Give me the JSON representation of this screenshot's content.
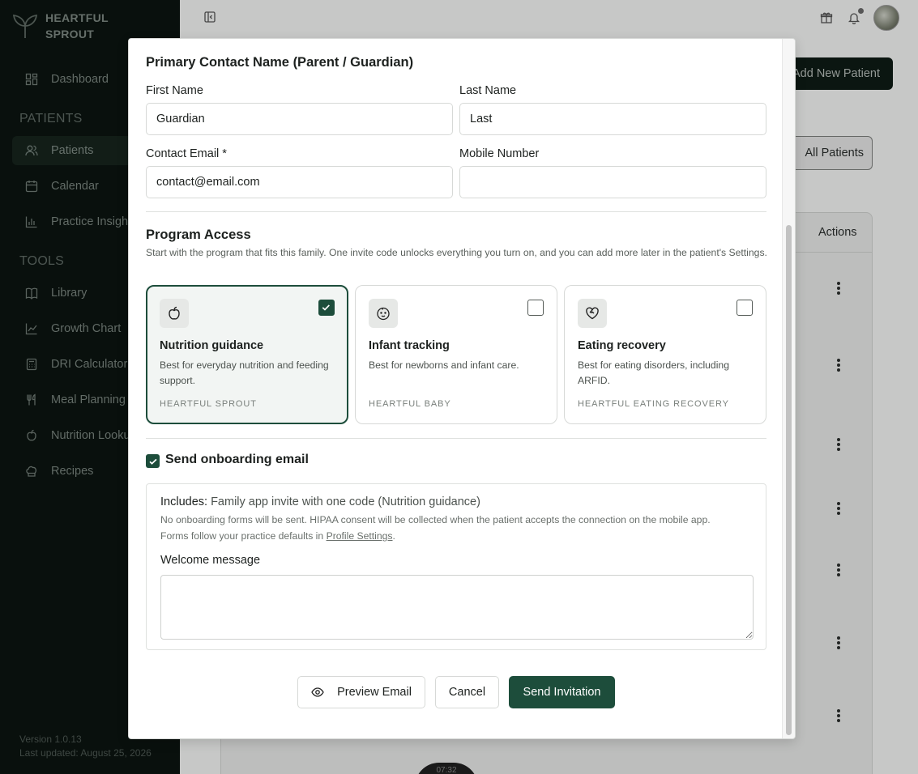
{
  "brand": {
    "line1": "HEARTFUL",
    "line2": "SPROUT"
  },
  "sidebar": {
    "dashboard": "Dashboard",
    "patients_section": "PATIENTS",
    "patients": "Patients",
    "calendar": "Calendar",
    "practice_insights": "Practice Insights",
    "tools_section": "TOOLS",
    "library": "Library",
    "growth_chart": "Growth Chart",
    "dri_calculator": "DRI Calculator",
    "meal_planning": "Meal Planning",
    "nutrition_lookup": "Nutrition Lookup",
    "recipes": "Recipes",
    "version": "Version 1.0.13",
    "last_updated": "Last updated: August 25, 2026"
  },
  "background": {
    "add_patient": "Add New Patient",
    "all_patients": "All Patients",
    "actions_header": "Actions",
    "time_chip": "07:32"
  },
  "modal": {
    "contact_title": "Primary Contact Name (Parent / Guardian)",
    "first_name_label": "First Name",
    "first_name_value": "Guardian",
    "last_name_label": "Last Name",
    "last_name_value": "Last",
    "email_label": "Contact Email *",
    "email_value": "contact@email.com",
    "mobile_label": "Mobile Number",
    "mobile_value": "",
    "program_title": "Program Access",
    "program_help": "Start with the program that fits this family. One invite code unlocks everything you turn on, and you can add more later in the patient's Settings.",
    "programs": [
      {
        "title": "Nutrition guidance",
        "desc": "Best for everyday nutrition and feeding support.",
        "tag": "HEARTFUL SPROUT",
        "checked": true
      },
      {
        "title": "Infant tracking",
        "desc": "Best for newborns and infant care.",
        "tag": "HEARTFUL BABY",
        "checked": false
      },
      {
        "title": "Eating recovery",
        "desc": "Best for eating disorders, including ARFID.",
        "tag": "HEARTFUL EATING RECOVERY",
        "checked": false
      }
    ],
    "onboard_label": "Send onboarding email",
    "includes_label": "Includes:",
    "includes_value": "Family app invite with one code (Nutrition guidance)",
    "note_line1": "No onboarding forms will be sent. HIPAA consent will be collected when the patient accepts the connection on the mobile app.",
    "note_line2_prefix": "Forms follow your practice defaults in",
    "note_link": "Profile Settings",
    "note_line2_suffix": ".",
    "welcome_label": "Welcome message",
    "welcome_value": "",
    "preview_button": "Preview Email",
    "cancel_button": "Cancel",
    "send_button": "Send Invitation"
  },
  "colors": {
    "accent": "#1d4d3b",
    "sidebar_bg": "#0b1410"
  }
}
